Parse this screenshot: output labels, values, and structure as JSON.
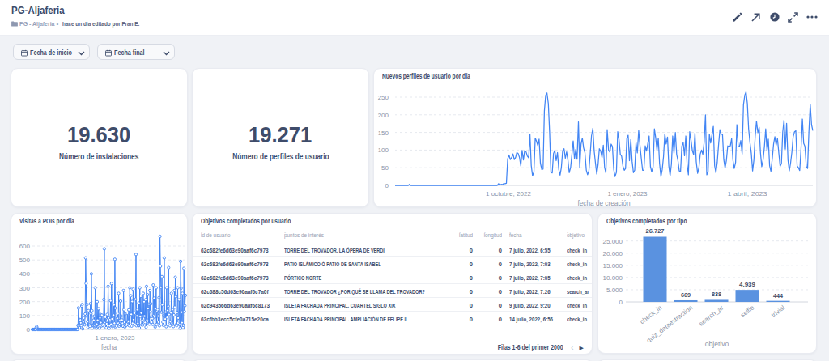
{
  "header": {
    "title": "PG-Aljaferia",
    "breadcrumb": "PG - Aljaferia",
    "separator": "•",
    "edited": "hace un día editado por Fran E."
  },
  "filters": {
    "start_label": "Fecha de inicio",
    "end_label": "Fecha final"
  },
  "scorecards": [
    {
      "value": "19.630",
      "label": "Número de instalaciones"
    },
    {
      "value": "19.271",
      "label": "Número de perfiles de usuario"
    }
  ],
  "colors": {
    "accent_blue": "#4285f4",
    "bar_blue": "#5a92e0",
    "navy_text": "#3e4c6a",
    "muted_text": "#8a93a6"
  },
  "chart_data": [
    {
      "type": "line",
      "title": "Nuevos perfiles de usuario por día",
      "xlabel": "fecha de creación",
      "ylabel": "",
      "ylim": [
        0,
        250
      ],
      "yticks": [
        0,
        50,
        100,
        150,
        200,
        250
      ],
      "xticks": [
        {
          "label": "1 octubre, 2022",
          "frac": 0.2713
        },
        {
          "label": "1 enero, 2023",
          "frac": 0.5562
        },
        {
          "label": "1 abril, 2023",
          "frac": 0.843
        }
      ],
      "grid": "dashed",
      "legend": "none",
      "values": [
        0,
        0,
        0,
        0,
        0,
        0,
        0,
        0,
        0,
        0,
        0,
        3,
        0,
        0,
        0,
        0,
        0,
        0,
        0,
        0,
        0,
        0,
        0,
        0,
        0,
        0,
        0,
        0,
        0,
        0,
        0,
        0,
        0,
        0,
        0,
        0,
        0,
        0,
        0,
        0,
        0,
        0,
        0,
        0,
        0,
        0,
        0,
        0,
        0,
        0,
        0,
        0,
        0,
        0,
        0,
        0,
        0,
        0,
        0,
        0,
        0,
        0,
        0,
        0,
        0,
        0,
        0,
        0,
        0,
        0,
        0,
        0,
        0,
        0,
        0,
        0,
        0,
        0,
        0,
        5,
        1,
        3,
        2,
        5,
        5,
        6,
        75,
        86,
        73,
        79,
        89,
        73,
        79,
        93,
        90,
        79,
        55,
        99,
        72,
        99,
        95,
        83,
        78,
        145,
        56,
        27,
        38,
        134,
        125,
        113,
        131,
        63,
        45,
        46,
        210,
        255,
        262,
        232,
        150,
        37,
        35,
        90,
        99,
        70,
        93,
        45,
        29,
        51,
        98,
        104,
        77,
        95,
        72,
        36,
        50,
        87,
        126,
        75,
        102,
        74,
        180,
        49,
        117,
        134,
        106,
        93,
        43,
        30,
        41,
        89,
        140,
        162,
        98,
        63,
        32,
        58,
        104,
        97,
        79,
        114,
        51,
        35,
        158,
        100,
        94,
        117,
        110,
        45,
        25,
        37,
        152,
        130,
        88,
        83,
        54,
        43,
        48,
        134,
        142,
        70,
        130,
        68,
        36,
        43,
        121,
        92,
        155,
        113,
        77,
        43,
        43,
        112,
        97,
        119,
        140,
        54,
        38,
        53,
        160,
        135,
        99,
        134,
        62,
        25,
        45,
        82,
        146,
        117,
        137,
        55,
        27,
        60,
        140,
        91,
        150,
        88,
        70,
        41,
        39,
        111,
        121,
        84,
        140,
        59,
        30,
        152,
        127,
        98,
        87,
        148,
        67,
        34,
        50,
        88,
        100,
        88,
        121,
        200,
        30,
        38,
        145,
        120,
        143,
        167,
        56,
        36,
        65,
        113,
        158,
        145,
        145,
        73,
        49,
        70,
        112,
        110,
        112,
        133,
        72,
        48,
        65,
        172,
        110,
        110,
        127,
        89,
        228,
        255,
        265,
        232,
        160,
        120,
        91,
        41,
        72,
        139,
        182,
        149,
        165,
        93,
        53,
        71,
        110,
        160,
        98,
        131,
        56,
        40,
        76,
        117,
        138,
        114,
        133,
        93,
        54,
        62,
        151,
        185,
        103,
        176,
        72,
        41,
        63,
        94,
        138,
        152,
        155,
        55,
        50,
        42,
        103,
        188,
        119,
        110,
        54,
        48,
        150,
        230,
        172,
        155
      ]
    },
    {
      "type": "line",
      "title": "Visitas a POIs por día",
      "xlabel": "fecha",
      "ylabel": "",
      "ylim": [
        0,
        700
      ],
      "yticks": [
        0,
        100,
        200,
        300,
        400,
        500,
        600
      ],
      "xticks": [
        {
          "label": "1 enero, 2023",
          "frac": 0.5397
        }
      ],
      "grid": "dashed",
      "legend": "none",
      "markers": true,
      "values": [
        0,
        0,
        0,
        0,
        0,
        0,
        0,
        0,
        14,
        20,
        9,
        0,
        0,
        0,
        0,
        0,
        0,
        0,
        0,
        0,
        0,
        0,
        0,
        0,
        0,
        0,
        0,
        0,
        0,
        0,
        0,
        0,
        0,
        0,
        0,
        0,
        0,
        0,
        0,
        0,
        0,
        0,
        0,
        0,
        0,
        0,
        0,
        0,
        0,
        0,
        0,
        0,
        0,
        0,
        0,
        0,
        0,
        0,
        0,
        0,
        0,
        0,
        0,
        0,
        0,
        0,
        0,
        0,
        0,
        0,
        0,
        0,
        0,
        0,
        0,
        0,
        0,
        0,
        0,
        0,
        0,
        0,
        0,
        0,
        0,
        0,
        0,
        0,
        0,
        0,
        0,
        0,
        0,
        0,
        0,
        29,
        155,
        24,
        12,
        71,
        69,
        48,
        28,
        169,
        180,
        4,
        53,
        82,
        37,
        33,
        111,
        515,
        330,
        97,
        180,
        57,
        16,
        135,
        29,
        32,
        22,
        185,
        114,
        400,
        135,
        10,
        31,
        30,
        67,
        95,
        30,
        300,
        16,
        9,
        37,
        199,
        66,
        18,
        149,
        21,
        10,
        83,
        107,
        49,
        25,
        103,
        38,
        28,
        38,
        215,
        580,
        48,
        88,
        37,
        12,
        41,
        108,
        69,
        310,
        82,
        9,
        27,
        71,
        207,
        38,
        330,
        76,
        21,
        24,
        103,
        177,
        45,
        505,
        154,
        14,
        24,
        61,
        80,
        115,
        45,
        260,
        24,
        35,
        65,
        204,
        96,
        38,
        68,
        45,
        23,
        280,
        142,
        52,
        18,
        114,
        31,
        30,
        41,
        117,
        53,
        59,
        141,
        27,
        300,
        111,
        243,
        109,
        24,
        201,
        44,
        290,
        71,
        119,
        117,
        37,
        217,
        540,
        27,
        97,
        143,
        44,
        30,
        190,
        11,
        300,
        92,
        239,
        118,
        33,
        67,
        32,
        260,
        96,
        199,
        96,
        50,
        214,
        17,
        310,
        69,
        250,
        151,
        41,
        183,
        38,
        280,
        127,
        185,
        89,
        52,
        78,
        36,
        320,
        98,
        225,
        89,
        18,
        150,
        300,
        36,
        129,
        142,
        96,
        53,
        229,
        26,
        670,
        455,
        304,
        124,
        380,
        178,
        53,
        30,
        97,
        515,
        123,
        75,
        125,
        20,
        300,
        86,
        137,
        168,
        445,
        107,
        39,
        26,
        56,
        120,
        260,
        46,
        143,
        31,
        21,
        105,
        280,
        161,
        375,
        236,
        35,
        28,
        123,
        300,
        82,
        61,
        213,
        34,
        9,
        490,
        297,
        124,
        49,
        260,
        13,
        30,
        440,
        129,
        171,
        245
      ]
    },
    {
      "type": "bar",
      "title": "Objetivos completados por tipo",
      "xlabel": "objetivo",
      "ylabel": "",
      "categories": [
        "check_in",
        "quiz_dataextraction",
        "search_ar",
        "selfie",
        "trivial"
      ],
      "values": [
        26727,
        669,
        838,
        4939,
        444
      ],
      "value_labels": [
        "26.727",
        "669",
        "838",
        "4.939",
        "444"
      ],
      "ylim": [
        0,
        27500
      ],
      "yticks": [
        0,
        5000,
        10000,
        15000,
        20000,
        25000
      ],
      "ytick_labels": [
        "0",
        "5.000",
        "10.000",
        "15.000",
        "20.000",
        "25.000"
      ],
      "grid": "dashed",
      "legend": "none"
    }
  ],
  "icons": {
    "folder-icon": "folder",
    "edit-icon": "pencil",
    "open-link-icon": "arrow-up-right",
    "clock-icon": "clock-filled-circle",
    "fullscreen-icon": "diagonal-expand-arrows",
    "more-icon": "three-dots",
    "calendar-icon": "calendar",
    "chevron-down-icon": "chevron-down",
    "sort-caret-icon": "caret-up",
    "pagination-prev-icon": "chevron-left",
    "pagination-next-icon": "triangle-right"
  },
  "table": {
    "title": "Objetivos completados por usuario",
    "sort_caret": "ˆ",
    "prev_icon": "‹",
    "next_icon": "▶",
    "columns": [
      "id de usuario",
      "puntos de interés",
      "latitud",
      "longitud",
      "fecha",
      "objetivo"
    ],
    "rows": [
      [
        "62c682fe6d63e90aaf6c7973",
        "TORRE DEL TROVADOR. LA ÓPERA DE VERDI",
        "0",
        "0",
        "7 julio, 2022, 6:55",
        "check_in"
      ],
      [
        "62c682fe6d63e90aaf6c7973",
        "PATIO ISLÁMICO Ó PATIO DE SANTA ISABEL",
        "0",
        "0",
        "7 julio, 2022, 7:03",
        "check_in"
      ],
      [
        "62c682fe6d63e90aaf6c7973",
        "PÓRTICO NORTE",
        "0",
        "0",
        "7 julio, 2022, 7:05",
        "check_in"
      ],
      [
        "62c688c56d63e90aaf6c7a0f",
        "TORRE DEL TROVADOR ¿POR QUÉ SE LLAMA DEL TROVADOR?",
        "0",
        "0",
        "7 julio, 2022, 7:26",
        "search_ar"
      ],
      [
        "62c943566d63e90aaf6c8173",
        "ISLETA FACHADA PRINCIPAL. CUARTEL SIGLO XIX",
        "0",
        "0",
        "9 julio, 2022, 9:20",
        "check_in"
      ],
      [
        "62cfbb3ecc5cfe0a715e20ca",
        "ISLETA FACHADA PRINCIPAL. AMPLIACIÓN DE FELIPE II",
        "0",
        "0",
        "14 julio, 2022, 6:56",
        "check_in"
      ]
    ],
    "pagination": "Filas 1-6 del primer 2000"
  }
}
